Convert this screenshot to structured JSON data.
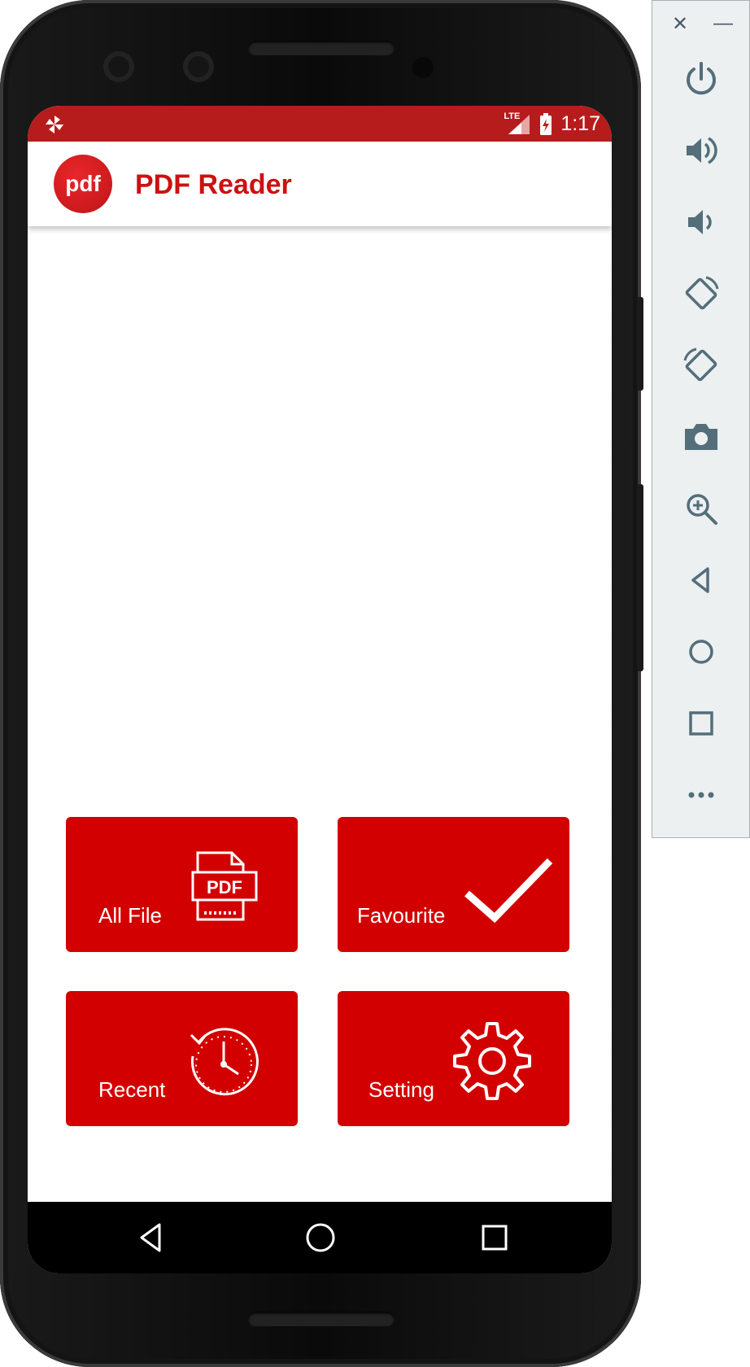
{
  "app": {
    "title": "PDF Reader",
    "logo_text": "pdf"
  },
  "status_bar": {
    "network": "LTE",
    "time": "1:17"
  },
  "tiles": [
    {
      "label": "All File",
      "icon": "pdf-file-icon"
    },
    {
      "label": "Favourite",
      "icon": "checkmark-icon"
    },
    {
      "label": "Recent",
      "icon": "clock-history-icon"
    },
    {
      "label": "Setting",
      "icon": "gear-icon"
    }
  ],
  "navigation": {
    "back": "back-icon",
    "home": "home-icon",
    "overview": "overview-icon"
  },
  "emulator_toolbar": {
    "close": "✕",
    "minimize": "—",
    "buttons": [
      "power-icon",
      "volume-up-icon",
      "volume-down-icon",
      "rotate-left-icon",
      "rotate-right-icon",
      "camera-icon",
      "zoom-icon",
      "back-icon",
      "home-icon",
      "overview-icon",
      "more-icon"
    ]
  },
  "colors": {
    "status_bar": "#b71c1c",
    "accent": "#d30000",
    "title": "#cc1111"
  }
}
